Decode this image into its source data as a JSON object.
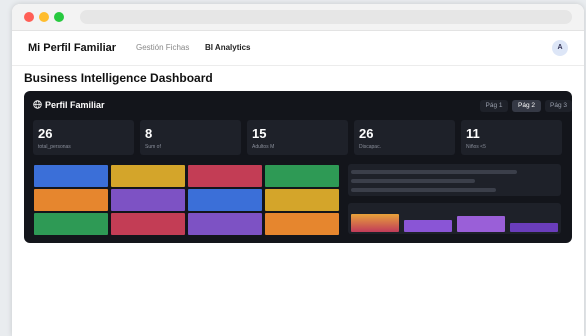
{
  "nav": {
    "brand": "Mi Perfil Familiar",
    "items": [
      "Gestión Fichas",
      "BI Analytics"
    ],
    "avatar": "A"
  },
  "page_title": "Business Intelligence Dashboard",
  "panel": {
    "title": "Perfil Familiar",
    "tabs": [
      "Pág 1",
      "Pág 2",
      "Pág 3"
    ],
    "active_tab": "Pág 2",
    "kpis": [
      {
        "value": "26",
        "label": "total_personas"
      },
      {
        "value": "8",
        "label": "Sum of"
      },
      {
        "value": "15",
        "label": "Adultos M"
      },
      {
        "value": "26",
        "label": "Discapac."
      },
      {
        "value": "11",
        "label": "Niños <5"
      }
    ]
  },
  "colors": {
    "treemap": [
      "#3b6fd8",
      "#d4a52a",
      "#c33d55",
      "#2e9a55",
      "#e6862e",
      "#7d52c4",
      "#3b6fd8",
      "#d4a52a",
      "#2e9a55",
      "#c33d55",
      "#7d52c4",
      "#e6862e"
    ],
    "bars": [
      "#e6862e",
      "#8a55d6",
      "#9a5fd8",
      "#6a3dbb"
    ]
  },
  "bar_levels": [
    0.9,
    0.6,
    0.8,
    0.45
  ]
}
